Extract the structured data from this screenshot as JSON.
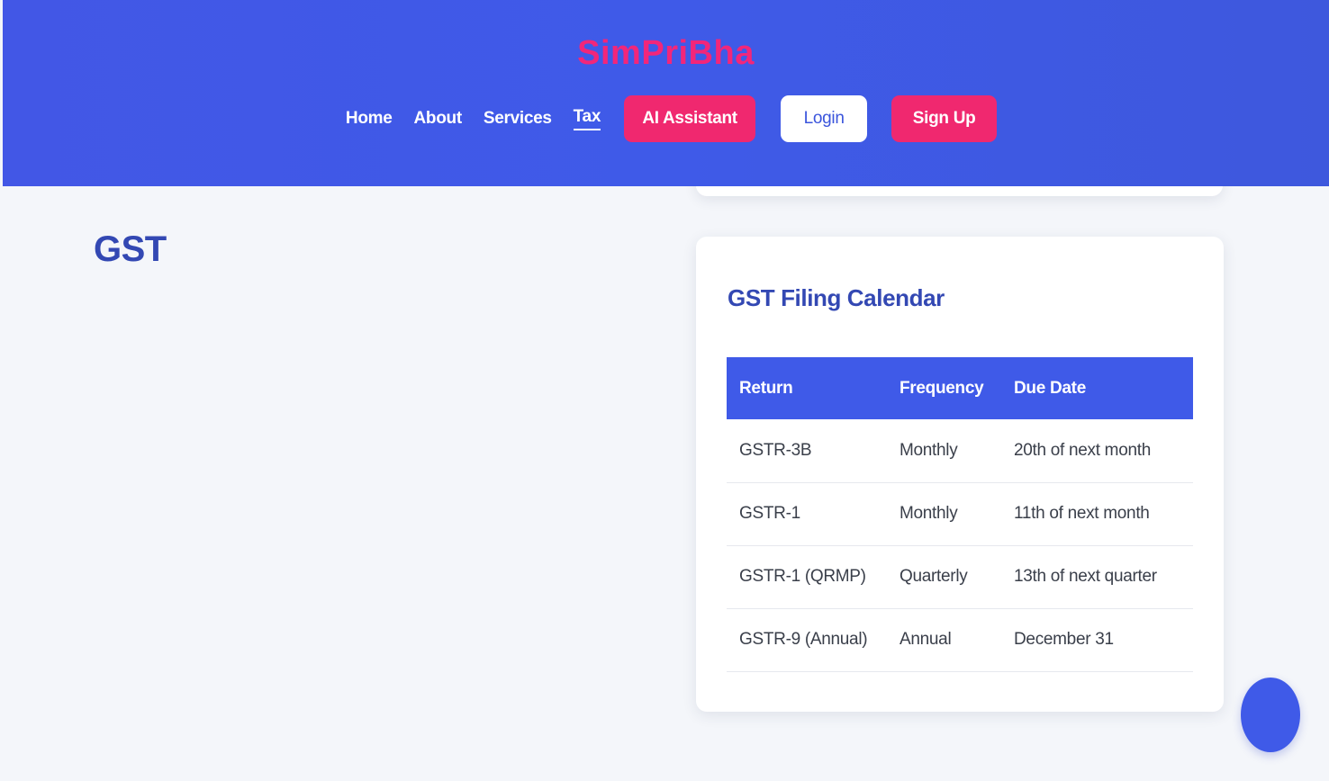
{
  "header": {
    "brand": "SimPriBha",
    "nav": {
      "home": "Home",
      "about": "About",
      "services": "Services",
      "tax": "Tax"
    },
    "buttons": {
      "ai_assistant": "AI Assistant",
      "login": "Login",
      "signup": "Sign Up"
    }
  },
  "main": {
    "title": "GST"
  },
  "calendar": {
    "title": "GST Filing Calendar",
    "columns": [
      "Return",
      "Frequency",
      "Due Date"
    ],
    "rows": [
      [
        "GSTR-3B",
        "Monthly",
        "20th of next month"
      ],
      [
        "GSTR-1",
        "Monthly",
        "11th of next month"
      ],
      [
        "GSTR-1 (QRMP)",
        "Quarterly",
        "13th of next quarter"
      ],
      [
        "GSTR-9 (Annual)",
        "Annual",
        "December 31"
      ]
    ]
  },
  "colors": {
    "primary": "#3f5ae8",
    "accent": "#f0286f",
    "heading": "#3348b3"
  },
  "icons": {
    "chat_bubble": "chat-bubble-icon"
  }
}
